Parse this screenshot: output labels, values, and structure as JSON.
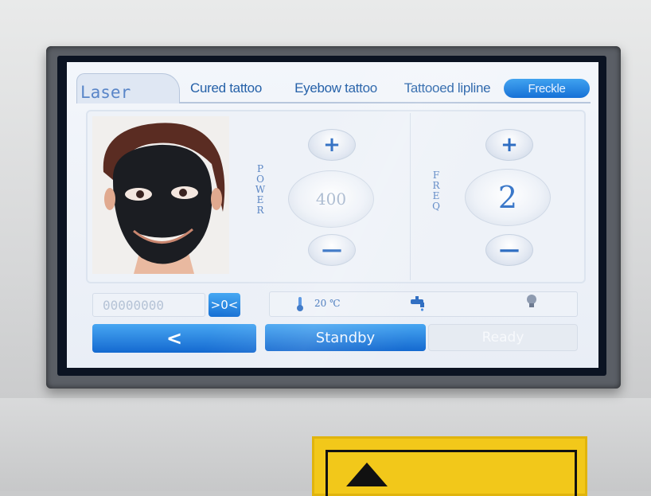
{
  "tabs": {
    "active_mode": "Laser",
    "items": [
      "Cured tattoo",
      "Eyebow tattoo",
      "Tattooed lipline",
      "Freckle"
    ],
    "selected": "Freckle"
  },
  "power": {
    "label_letters": [
      "P",
      "O",
      "W",
      "E",
      "R"
    ],
    "value": "400",
    "plus_icon": "plus-icon",
    "minus_icon": "minus-icon"
  },
  "freq": {
    "label_letters": [
      "F",
      "R",
      "E",
      "Q"
    ],
    "value": "2"
  },
  "status": {
    "counter": "00000000",
    "reset_label": ">0<",
    "temperature": "20 ℃",
    "icons": [
      "thermometer-icon",
      "water-tap-icon",
      "lamp-icon"
    ]
  },
  "bottom": {
    "back_label": "<",
    "standby_label": "Standby",
    "ready_label": "Ready"
  },
  "colors": {
    "accent": "#1a74d8",
    "text_blue": "#2561a8",
    "disabled": "#b5c3d6"
  }
}
